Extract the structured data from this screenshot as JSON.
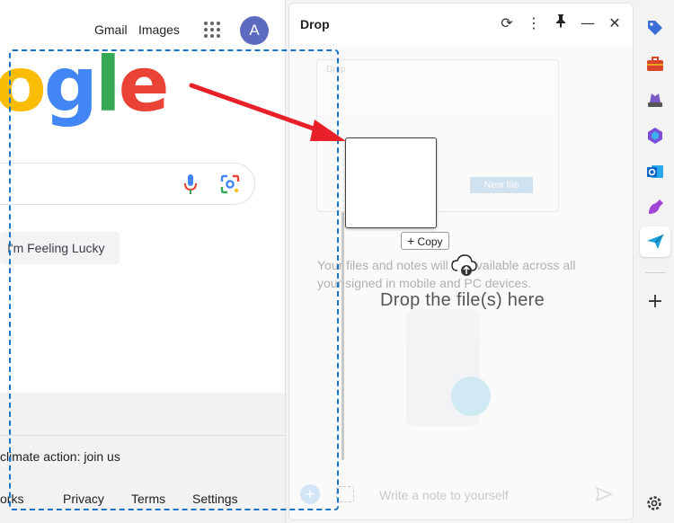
{
  "google": {
    "top_links": {
      "gmail": "Gmail",
      "images": "Images"
    },
    "avatar_letter": "A",
    "logo_text": {
      "o": "o",
      "g": "g",
      "l": "l",
      "e": "e"
    },
    "lucky_button": "I'm Feeling Lucky",
    "footer": {
      "climate_text": "climate action: join us",
      "links": {
        "works": "orks",
        "privacy": "Privacy",
        "terms": "Terms",
        "settings": "Settings"
      }
    }
  },
  "drop": {
    "title": "Drop",
    "drag_badge": "Copy",
    "drop_hint": "Drop the file(s) here",
    "background_note": "Your files and notes will be available across all your signed in mobile and PC devices.",
    "inner_title": "Drop",
    "inner_new_file": "New file",
    "note_placeholder": "Write a note to yourself"
  },
  "colors": {
    "accent": "#1a73c8",
    "arrow": "#e8202a",
    "avatar_bg": "#5c6bc0"
  }
}
